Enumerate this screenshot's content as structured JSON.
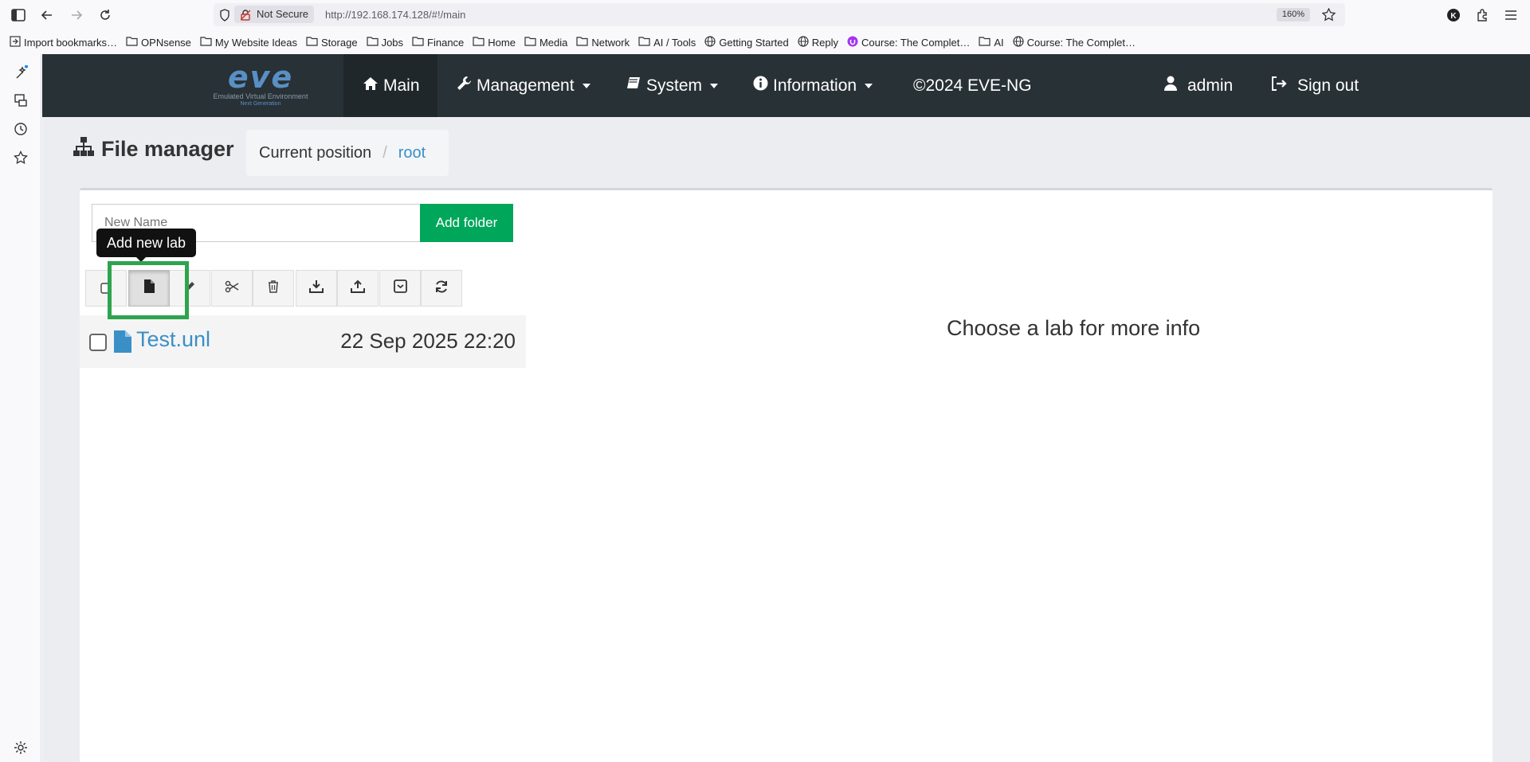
{
  "browser": {
    "not_secure_label": "Not Secure",
    "url": "http://192.168.174.128/#!/main",
    "zoom": "160%",
    "bookmarks": [
      {
        "label": "Import bookmarks…",
        "icon": "import-icon"
      },
      {
        "label": "OPNsense",
        "icon": "folder-icon"
      },
      {
        "label": "My Website Ideas",
        "icon": "folder-icon"
      },
      {
        "label": "Storage",
        "icon": "folder-icon"
      },
      {
        "label": "Jobs",
        "icon": "folder-icon"
      },
      {
        "label": "Finance",
        "icon": "folder-icon"
      },
      {
        "label": "Home",
        "icon": "folder-icon"
      },
      {
        "label": "Media",
        "icon": "folder-icon"
      },
      {
        "label": "Network",
        "icon": "folder-icon"
      },
      {
        "label": "AI / Tools",
        "icon": "folder-icon"
      },
      {
        "label": "Getting Started",
        "icon": "globe-icon"
      },
      {
        "label": "Reply",
        "icon": "globe-icon"
      },
      {
        "label": "Course: The Complet…",
        "icon": "udemy-icon"
      },
      {
        "label": "AI",
        "icon": "folder-icon"
      },
      {
        "label": "Course: The Complet…",
        "icon": "globe-icon"
      }
    ]
  },
  "app": {
    "logo": {
      "text": "eve",
      "tagline": "Emulated Virtual Environment",
      "subtagline": "Next Generation"
    },
    "nav": {
      "main": "Main",
      "management": "Management",
      "system": "System",
      "information": "Information",
      "copyright": "©2024 EVE-NG",
      "user": "admin",
      "signout": "Sign out"
    },
    "page_title": "File manager",
    "breadcrumb": {
      "label": "Current position",
      "separator": "/",
      "current": "root"
    },
    "new_name_placeholder": "New Name",
    "add_folder": "Add folder",
    "tooltip": "Add new lab",
    "files": [
      {
        "name": "Test.unl",
        "date": "22 Sep 2025 22:20"
      }
    ],
    "info_text": "Choose a lab for more info"
  },
  "colors": {
    "navbar": "#283136",
    "accent_green": "#00a65a",
    "link_blue": "#3a8fc7",
    "highlight_green": "#2ea44f"
  }
}
